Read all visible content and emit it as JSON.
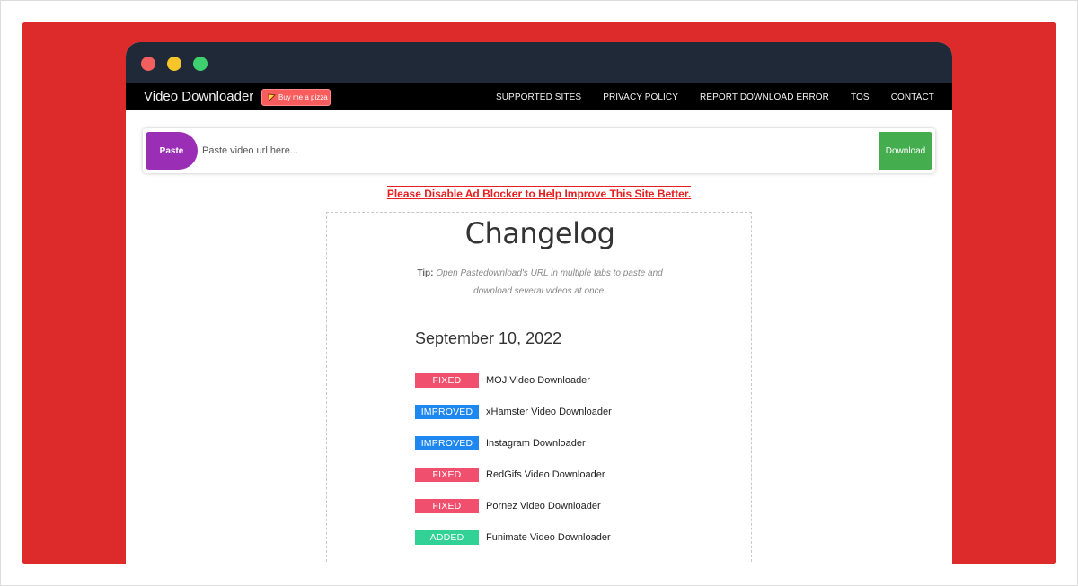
{
  "navbar": {
    "brand": "Video Downloader",
    "pizza_label": "Buy me a pizza",
    "links": [
      "SUPPORTED SITES",
      "PRIVACY POLICY",
      "REPORT DOWNLOAD ERROR",
      "TOS",
      "CONTACT"
    ]
  },
  "search": {
    "paste_label": "Paste",
    "placeholder": "Paste video url here...",
    "download_label": "Download"
  },
  "adblock_message": "Please Disable Ad Blocker to Help Improve This Site Better.",
  "changelog": {
    "title": "Changelog",
    "tip_label": "Tip:",
    "tip_text": "Open Pastedownload's URL in multiple tabs to paste and download several videos at once.",
    "date": "September 10, 2022",
    "entries": [
      {
        "badge": "FIXED",
        "text": "MOJ Video Downloader"
      },
      {
        "badge": "IMPROVED",
        "text": "xHamster Video Downloader"
      },
      {
        "badge": "IMPROVED",
        "text": "Instagram Downloader"
      },
      {
        "badge": "FIXED",
        "text": "RedGifs Video Downloader"
      },
      {
        "badge": "FIXED",
        "text": "Pornez Video Downloader"
      },
      {
        "badge": "ADDED",
        "text": "Funimate Video Downloader"
      }
    ]
  },
  "colors": {
    "background": "#dd2b2b",
    "titlebar": "#202938",
    "paste": "#9a2fb5",
    "download": "#44ad4e",
    "fixed": "#f0506e",
    "improved": "#1e87f0",
    "added": "#32d296"
  }
}
